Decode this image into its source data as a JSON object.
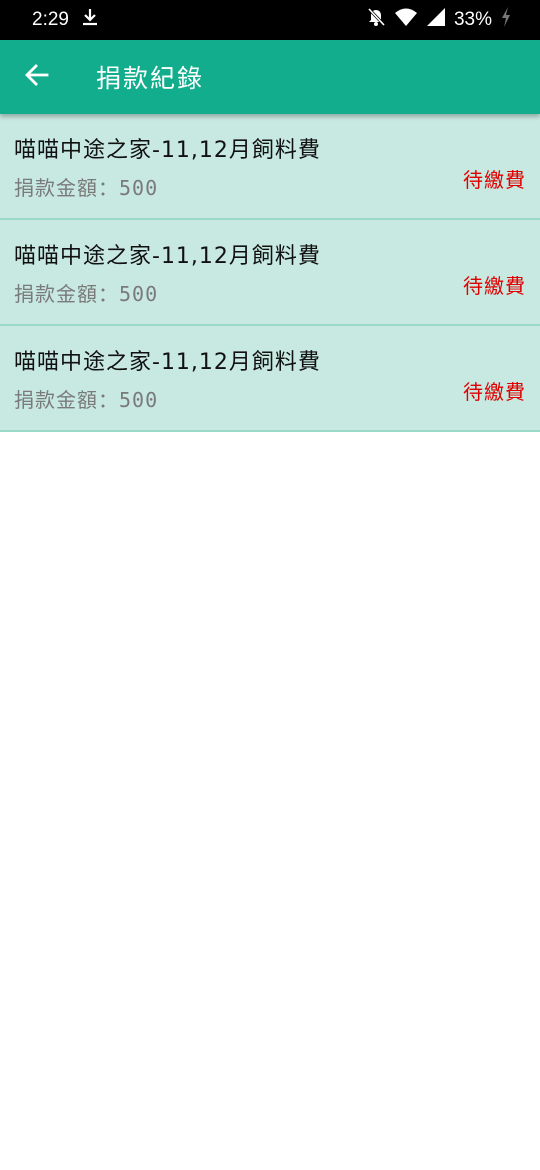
{
  "status_bar": {
    "time": "2:29",
    "battery": "33%",
    "icons": [
      "download-icon",
      "bell-off-icon",
      "wifi-icon",
      "signal-icon",
      "battery-charging-icon"
    ]
  },
  "app_bar": {
    "title": "捐款紀錄",
    "back_icon": "arrow-left-icon",
    "background": "#12ad8c"
  },
  "donations": [
    {
      "title": "喵喵中途之家-11,12月飼料費",
      "amount": "捐款金額：500",
      "status": "待繳費"
    },
    {
      "title": "喵喵中途之家-11,12月飼料費",
      "amount": "捐款金額：500",
      "status": "待繳費"
    },
    {
      "title": "喵喵中途之家-11,12月飼料費",
      "amount": "捐款金額：500",
      "status": "待繳費"
    }
  ],
  "colors": {
    "item_background": "#c8e9e1",
    "status_pending": "#e00000"
  }
}
